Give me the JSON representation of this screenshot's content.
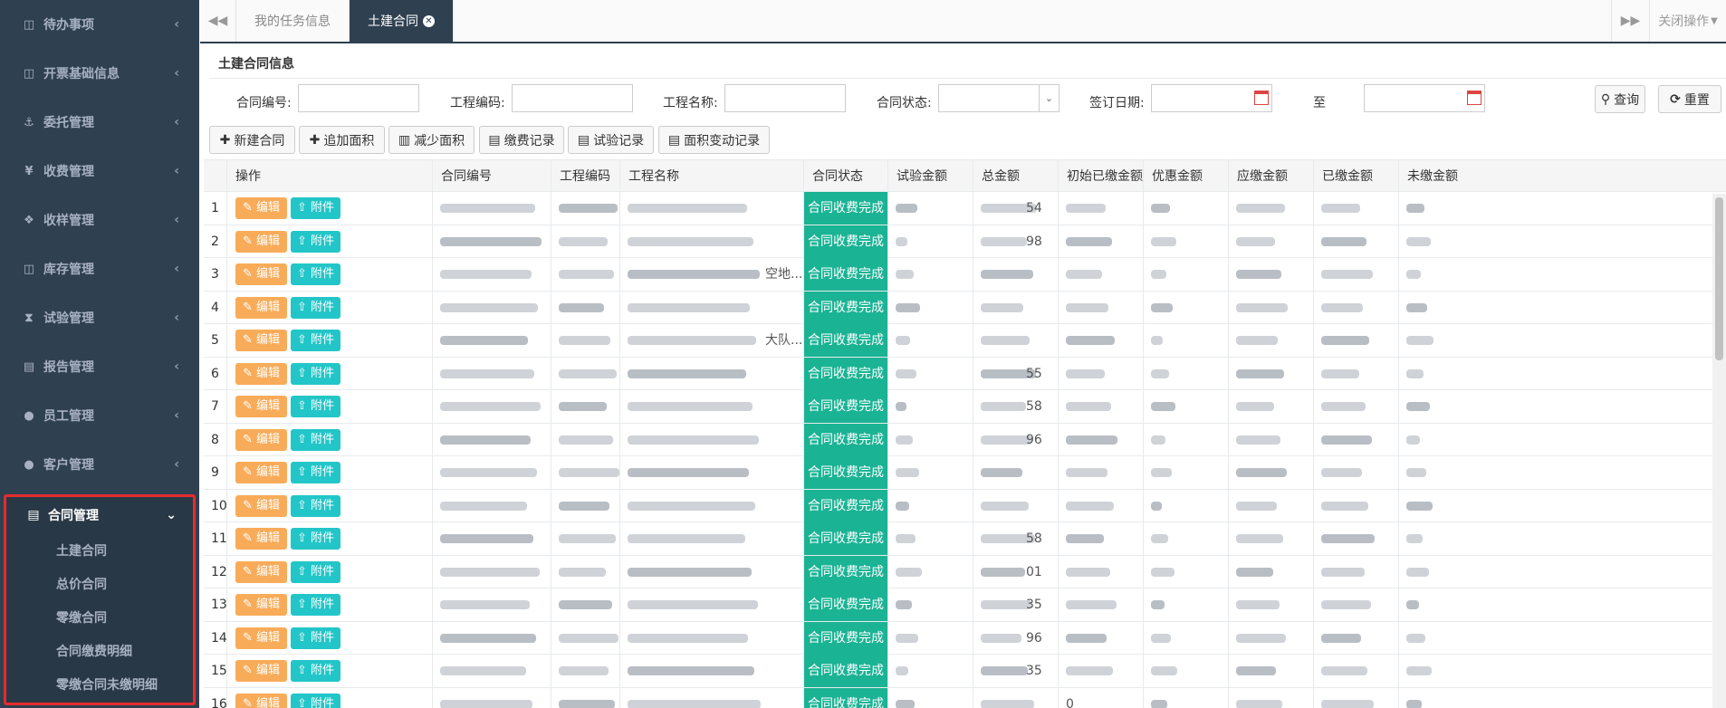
{
  "sidebar": {
    "items": [
      {
        "label": "待办事项",
        "icon": "panel-icon",
        "glyph": "◫"
      },
      {
        "label": "开票基础信息",
        "icon": "panel-icon",
        "glyph": "◫"
      },
      {
        "label": "委托管理",
        "icon": "anchor-icon",
        "glyph": "⚓"
      },
      {
        "label": "收费管理",
        "icon": "yen-icon",
        "glyph": "¥"
      },
      {
        "label": "收样管理",
        "icon": "cubes-icon",
        "glyph": "❖"
      },
      {
        "label": "库存管理",
        "icon": "panel-icon",
        "glyph": "◫"
      },
      {
        "label": "试验管理",
        "icon": "hourglass-icon",
        "glyph": "⧗"
      },
      {
        "label": "报告管理",
        "icon": "pdf-file-icon",
        "glyph": "▤"
      },
      {
        "label": "员工管理",
        "icon": "user-icon",
        "glyph": "●"
      },
      {
        "label": "客户管理",
        "icon": "users-icon",
        "glyph": "●"
      }
    ],
    "active_group": {
      "label": "合同管理",
      "icon": "file-icon",
      "glyph": "▤",
      "children": [
        "土建合同",
        "总价合同",
        "零缴合同",
        "合同缴费明细",
        "零缴合同未缴明细"
      ]
    }
  },
  "tabs": {
    "items": [
      "我的任务信息",
      "土建合同"
    ],
    "active": "土建合同",
    "close_ops": "关闭操作"
  },
  "page": {
    "title": "土建合同信息"
  },
  "filters": {
    "contract_no": "合同编号:",
    "project_code": "工程编码:",
    "project_name": "工程名称:",
    "contract_status": "合同状态:",
    "sign_date": "签订日期:",
    "to": "至",
    "search": "查询",
    "reset": "重置"
  },
  "toolbar": {
    "new_contract": "新建合同",
    "add_area": "追加面积",
    "reduce_area": "减少面积",
    "payment_records": "缴费记录",
    "test_records": "试验记录",
    "area_change_records": "面积变动记录"
  },
  "table": {
    "headers": [
      "操作",
      "合同编号",
      "工程编码",
      "工程名称",
      "合同状态",
      "试验金额",
      "总金额",
      "初始已缴金额",
      "优惠金额",
      "应缴金额",
      "已缴金额",
      "未缴金额"
    ],
    "edit_label": "编辑",
    "attach_label": "附件",
    "status_text": "合同收费完成",
    "rows": [
      {
        "no": "1",
        "total_suffix": "54"
      },
      {
        "no": "2",
        "total_suffix": "98"
      },
      {
        "no": "3",
        "name_suffix": "空地...",
        "total_suffix": ""
      },
      {
        "no": "4",
        "total_suffix": ""
      },
      {
        "no": "5",
        "name_suffix": "大队...",
        "total_suffix": ""
      },
      {
        "no": "6",
        "total_suffix": "55"
      },
      {
        "no": "7",
        "total_suffix": "58"
      },
      {
        "no": "8",
        "total_suffix": "96"
      },
      {
        "no": "9",
        "total_suffix": ""
      },
      {
        "no": "10",
        "total_suffix": ""
      },
      {
        "no": "11",
        "total_suffix": "58"
      },
      {
        "no": "12",
        "total_suffix": "01"
      },
      {
        "no": "13",
        "total_suffix": "35"
      },
      {
        "no": "14",
        "total_suffix": "96"
      },
      {
        "no": "15",
        "total_suffix": "35"
      },
      {
        "no": "16",
        "total_suffix": "",
        "initial_paid": "0"
      }
    ]
  }
}
